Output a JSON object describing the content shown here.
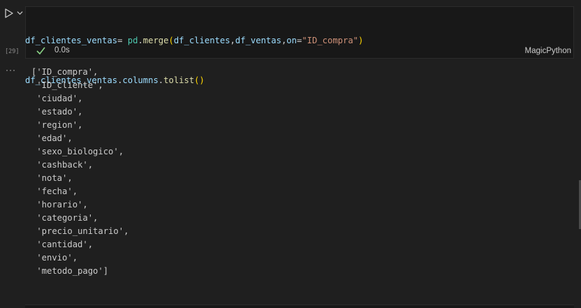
{
  "cell": {
    "code_line1": [
      {
        "t": "df_clientes_ventas",
        "c": "var"
      },
      {
        "t": "= ",
        "c": "op"
      },
      {
        "t": "pd",
        "c": "mod"
      },
      {
        "t": ".",
        "c": "op"
      },
      {
        "t": "merge",
        "c": "fn"
      },
      {
        "t": "(",
        "c": "paren"
      },
      {
        "t": "df_clientes",
        "c": "var"
      },
      {
        "t": ",",
        "c": "op"
      },
      {
        "t": "df_ventas",
        "c": "var"
      },
      {
        "t": ",",
        "c": "op"
      },
      {
        "t": "on",
        "c": "var"
      },
      {
        "t": "=",
        "c": "op"
      },
      {
        "t": "\"ID_compra\"",
        "c": "str"
      },
      {
        "t": ")",
        "c": "paren"
      }
    ],
    "code_line2": [
      {
        "t": "df_clientes_ventas",
        "c": "var"
      },
      {
        "t": ".",
        "c": "op"
      },
      {
        "t": "columns",
        "c": "var"
      },
      {
        "t": ".",
        "c": "op"
      },
      {
        "t": "tolist",
        "c": "fn"
      },
      {
        "t": "()",
        "c": "paren"
      }
    ],
    "execution_count": "[29]",
    "exec_time": "0.0s",
    "language": "MagicPython"
  },
  "output": {
    "more_label": "···",
    "lines": [
      "['ID_compra',",
      " 'ID_cliente',",
      " 'ciudad',",
      " 'estado',",
      " 'region',",
      " 'edad',",
      " 'sexo_biologico',",
      " 'cashback',",
      " 'nota',",
      " 'fecha',",
      " 'horario',",
      " 'categoria',",
      " 'precio_unitario',",
      " 'cantidad',",
      " 'envio',",
      " 'metodo_pago']"
    ]
  },
  "colors": {
    "background": "#1f1f1f",
    "cell_background": "#181818",
    "success_check": "#89d185"
  },
  "icons": {
    "run": "run-cell-icon",
    "chevron": "chevron-down-icon",
    "check": "check-icon"
  }
}
